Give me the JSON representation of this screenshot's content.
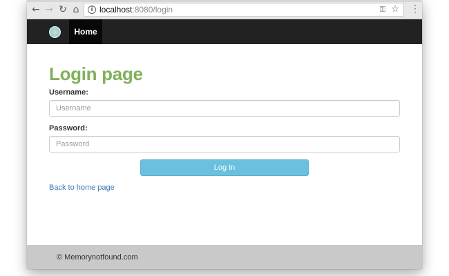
{
  "browser": {
    "url_host": "localhost",
    "url_rest": ":8080/login",
    "icons": {
      "back": "back-arrow-icon",
      "forward": "forward-arrow-icon",
      "reload": "reload-icon",
      "home": "home-icon",
      "info": "info-icon",
      "key": "key-icon",
      "star": "bookmark-star-icon",
      "menu": "kebab-menu-icon"
    }
  },
  "navbar": {
    "home_label": "Home"
  },
  "login": {
    "title": "Login page",
    "username_label": "Username:",
    "username_placeholder": "Username",
    "username_value": "",
    "password_label": "Password:",
    "password_placeholder": "Password",
    "password_value": "",
    "submit_label": "Log In",
    "back_link": "Back to home page"
  },
  "footer": {
    "text": "© Memorynotfound.com"
  },
  "colors": {
    "title": "#82b05c",
    "button": "#6ac0de",
    "link": "#3a77b3",
    "navbar": "#222222",
    "footer": "#c9c9c9"
  }
}
